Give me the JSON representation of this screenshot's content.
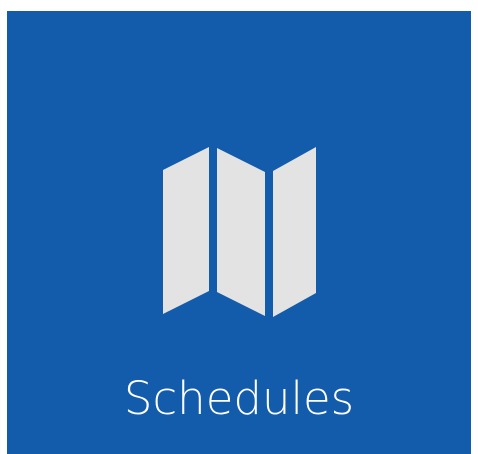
{
  "tile": {
    "label": "Schedules",
    "icon": "map-icon",
    "background_color": "#135bab",
    "icon_color": "#e3e3e3",
    "label_color": "#ffffff"
  }
}
